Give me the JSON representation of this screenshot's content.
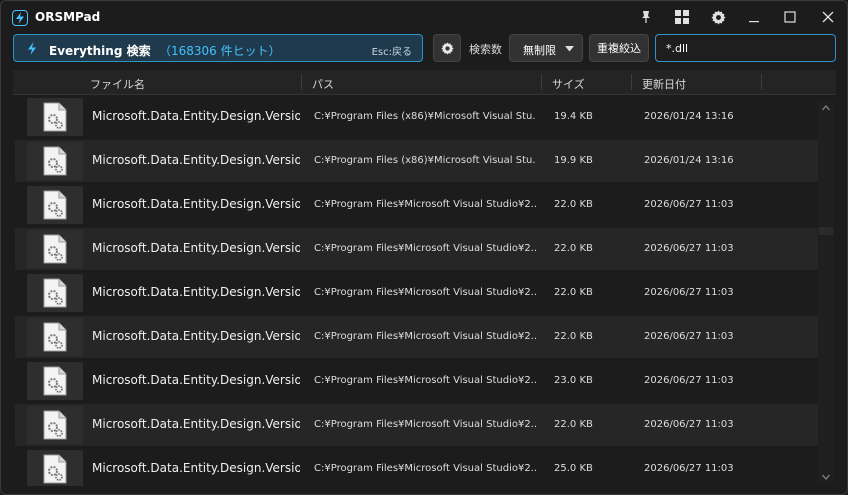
{
  "window": {
    "title": "ORSMPad"
  },
  "titlebar": {
    "buttons": [
      "pin-icon",
      "grid-icon",
      "gear-icon",
      "minimize-icon",
      "maximize-icon",
      "close-icon"
    ]
  },
  "search": {
    "engine_label": "Everything 検索",
    "hit_count": "（168306 件ヒット）",
    "hint": "Esc:戻る"
  },
  "toolbar": {
    "limit_label": "検索数",
    "limit_value": "無制限",
    "dedupe_label": "重複絞込",
    "filter_value": "*.dll"
  },
  "table": {
    "columns": [
      "ファイル名",
      "パス",
      "サイズ",
      "更新日付"
    ],
    "rows": [
      {
        "name": "Microsoft.Data.Entity.Design.Versioni...",
        "path": "C:¥Program Files (x86)¥Microsoft Visual Stu...",
        "size": "19.4 KB",
        "date": "2026/01/24 13:16"
      },
      {
        "name": "Microsoft.Data.Entity.Design.Versioni...",
        "path": "C:¥Program Files (x86)¥Microsoft Visual Stu...",
        "size": "19.9 KB",
        "date": "2026/01/24 13:16"
      },
      {
        "name": "Microsoft.Data.Entity.Design.Versioni...",
        "path": "C:¥Program Files¥Microsoft Visual Studio¥2...",
        "size": "22.0 KB",
        "date": "2026/06/27 11:03"
      },
      {
        "name": "Microsoft.Data.Entity.Design.Versioni...",
        "path": "C:¥Program Files¥Microsoft Visual Studio¥2...",
        "size": "22.0 KB",
        "date": "2026/06/27 11:03"
      },
      {
        "name": "Microsoft.Data.Entity.Design.Versioni...",
        "path": "C:¥Program Files¥Microsoft Visual Studio¥2...",
        "size": "22.0 KB",
        "date": "2026/06/27 11:03"
      },
      {
        "name": "Microsoft.Data.Entity.Design.Versioni...",
        "path": "C:¥Program Files¥Microsoft Visual Studio¥2...",
        "size": "22.0 KB",
        "date": "2026/06/27 11:03"
      },
      {
        "name": "Microsoft.Data.Entity.Design.Versioni...",
        "path": "C:¥Program Files¥Microsoft Visual Studio¥2...",
        "size": "23.0 KB",
        "date": "2026/06/27 11:03"
      },
      {
        "name": "Microsoft.Data.Entity.Design.Versioni...",
        "path": "C:¥Program Files¥Microsoft Visual Studio¥2...",
        "size": "22.0 KB",
        "date": "2026/06/27 11:03"
      },
      {
        "name": "Microsoft.Data.Entity.Design.Versioni...",
        "path": "C:¥Program Files¥Microsoft Visual Studio¥2...",
        "size": "25.0 KB",
        "date": "2026/06/27 11:03"
      }
    ]
  },
  "scrollbar": {
    "position": 0.32
  },
  "colors": {
    "accent": "#45c1ff",
    "search_bg": "#1f3a4d",
    "window_bg": "#1c1c1c",
    "row_alt": "#262626"
  }
}
